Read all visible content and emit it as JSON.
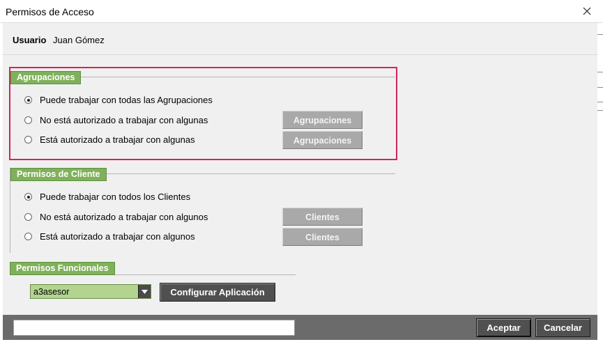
{
  "window": {
    "title": "Permisos de Acceso",
    "close_glyph": "✕"
  },
  "user": {
    "label": "Usuario",
    "name": "Juan Gómez"
  },
  "agrupaciones": {
    "header": "Agrupaciones",
    "options": [
      {
        "label": "Puede trabajar con todas las Agrupaciones",
        "checked": true
      },
      {
        "label": "No está autorizado a trabajar con algunas",
        "checked": false
      },
      {
        "label": "Está autorizado a trabajar con algunas",
        "checked": false
      }
    ],
    "button_label": "Agrupaciones"
  },
  "clientes": {
    "header": "Permisos de Cliente",
    "options": [
      {
        "label": "Puede trabajar con todos los Clientes",
        "checked": true
      },
      {
        "label": "No está autorizado a trabajar con algunos",
        "checked": false
      },
      {
        "label": "Está autorizado a trabajar con algunos",
        "checked": false
      }
    ],
    "button_label": "Clientes"
  },
  "funcionales": {
    "header": "Permisos Funcionales",
    "selected_app": "a3asesor",
    "configure_label": "Configurar Aplicación"
  },
  "footer": {
    "status_value": "",
    "accept_label": "Aceptar",
    "cancel_label": "Cancelar"
  },
  "colors": {
    "section_header": "#7fb15b",
    "highlight": "#d0245d",
    "combo": "#b3d48f",
    "dark_button": "#505050",
    "bottom_bar": "#6b6b6b"
  },
  "icons": {
    "close": "close-icon",
    "dropdown": "chevron-down-icon"
  }
}
